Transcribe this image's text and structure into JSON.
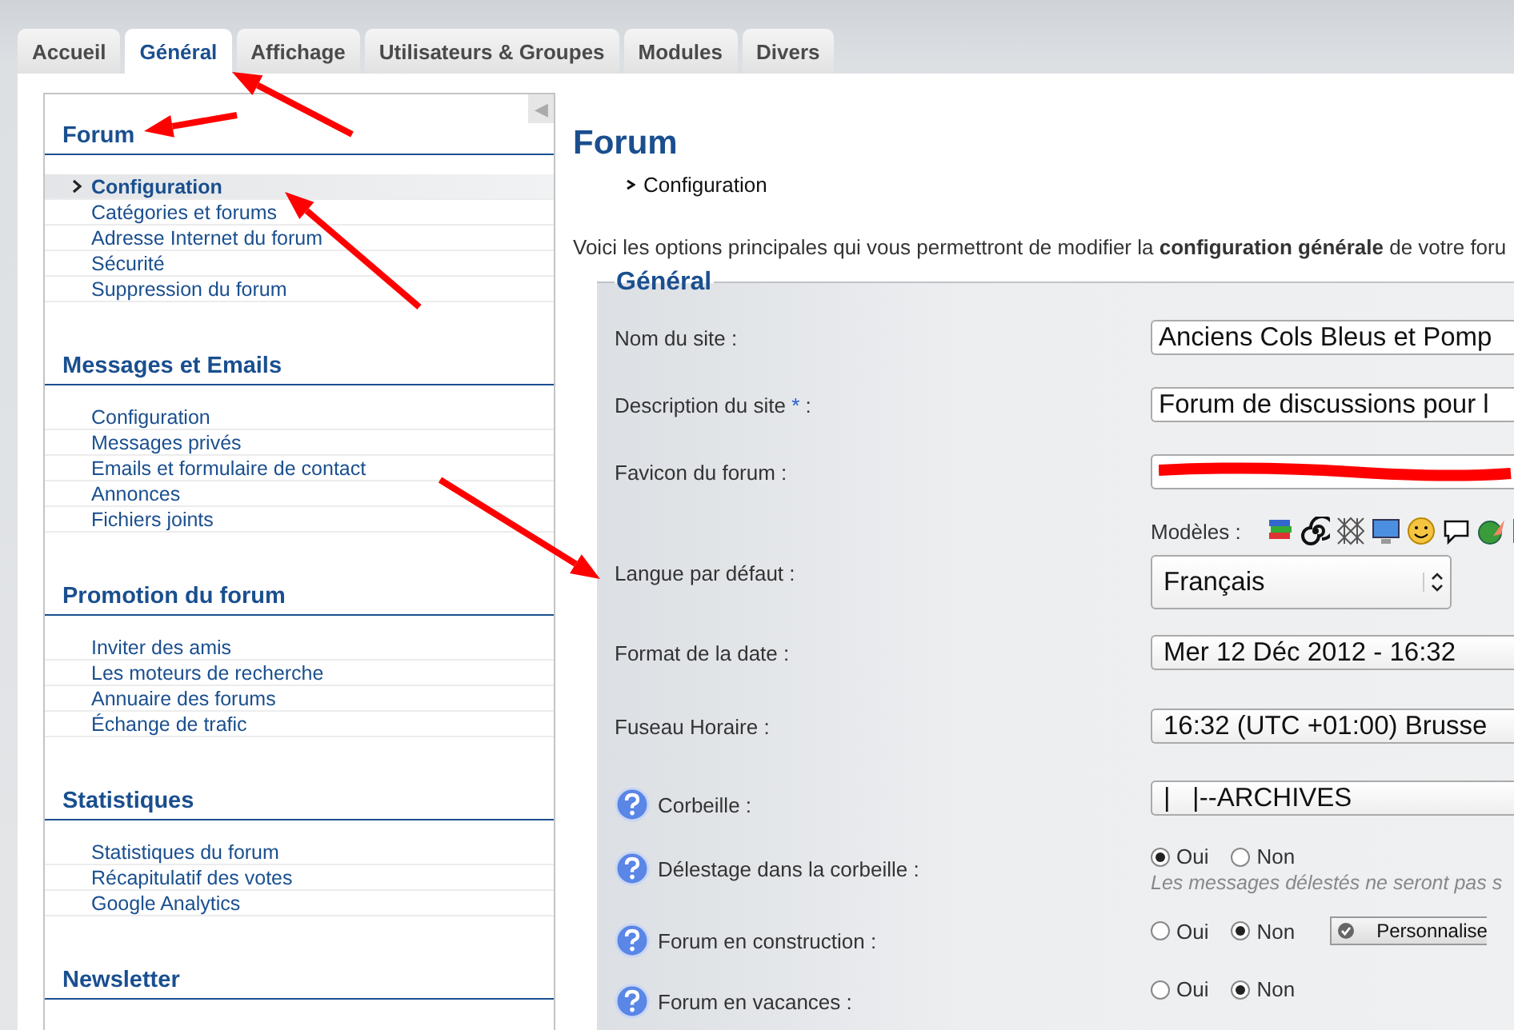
{
  "tabs": [
    {
      "label": "Accueil",
      "selected": false
    },
    {
      "label": "Général",
      "selected": true
    },
    {
      "label": "Affichage",
      "selected": false
    },
    {
      "label": "Utilisateurs & Groupes",
      "selected": false
    },
    {
      "label": "Modules",
      "selected": false
    },
    {
      "label": "Divers",
      "selected": false
    }
  ],
  "sidebar": {
    "collapse_button": "◀",
    "sections": [
      {
        "title": "Forum",
        "items": [
          {
            "label": "Configuration",
            "selected": true
          },
          {
            "label": "Catégories et forums",
            "selected": false
          },
          {
            "label": "Adresse Internet du forum",
            "selected": false
          },
          {
            "label": "Sécurité",
            "selected": false
          },
          {
            "label": "Suppression du forum",
            "selected": false
          }
        ]
      },
      {
        "title": "Messages et Emails",
        "items": [
          {
            "label": "Configuration",
            "selected": false
          },
          {
            "label": "Messages privés",
            "selected": false
          },
          {
            "label": "Emails et formulaire de contact",
            "selected": false
          },
          {
            "label": "Annonces",
            "selected": false
          },
          {
            "label": "Fichiers joints",
            "selected": false
          }
        ]
      },
      {
        "title": "Promotion du forum",
        "items": [
          {
            "label": "Inviter des amis",
            "selected": false
          },
          {
            "label": "Les moteurs de recherche",
            "selected": false
          },
          {
            "label": "Annuaire des forums",
            "selected": false
          },
          {
            "label": "Échange de trafic",
            "selected": false
          }
        ]
      },
      {
        "title": "Statistiques",
        "items": [
          {
            "label": "Statistiques du forum",
            "selected": false
          },
          {
            "label": "Récapitulatif des votes",
            "selected": false
          },
          {
            "label": "Google Analytics",
            "selected": false
          }
        ]
      },
      {
        "title": "Newsletter"
      }
    ]
  },
  "main": {
    "title": "Forum",
    "breadcrumb": "Configuration",
    "intro": "Voici les options principales qui vous permettront de modifier la **configuration générale** de votre foru",
    "fieldset": {
      "legend": "Général",
      "rows": [
        {
          "kind": "text",
          "label": "Nom du site :",
          "value": "Anciens Cols Bleus et Pomp"
        },
        {
          "kind": "text",
          "label": "Description du site",
          "required_mark": "*",
          "label_end": ":",
          "value": "Forum de discussions pour l"
        },
        {
          "kind": "redacted",
          "label": "Favicon du forum :"
        },
        {
          "kind": "icons",
          "label_right": "Modèles :"
        },
        {
          "kind": "spinner",
          "label": "Langue par défaut :",
          "value": "Français"
        },
        {
          "kind": "select",
          "label": "Format de la date :",
          "value": "Mer 12 Déc 2012 - 16:32"
        },
        {
          "kind": "select",
          "label": "Fuseau Horaire :",
          "value": "16:32 (UTC +01:00) Brusse"
        },
        {
          "kind": "select",
          "label": "Corbeille :",
          "help": true,
          "value": "|   |--ARCHIVES"
        },
        {
          "kind": "radio",
          "label": "Délestage dans la corbeille :",
          "help": true,
          "options": [
            {
              "label": "Oui",
              "selected": true
            },
            {
              "label": "Non",
              "selected": false
            }
          ],
          "hint": "Les messages délestés ne seront pas s"
        },
        {
          "kind": "radio",
          "label": "Forum en construction :",
          "help": true,
          "options": [
            {
              "label": "Oui",
              "selected": false
            },
            {
              "label": "Non",
              "selected": true
            }
          ],
          "button": "Personnalise"
        },
        {
          "kind": "radio",
          "label": "Forum en vacances :",
          "help": true,
          "options": [
            {
              "label": "Oui",
              "selected": false
            },
            {
              "label": "Non",
              "selected": true
            }
          ]
        }
      ]
    }
  }
}
